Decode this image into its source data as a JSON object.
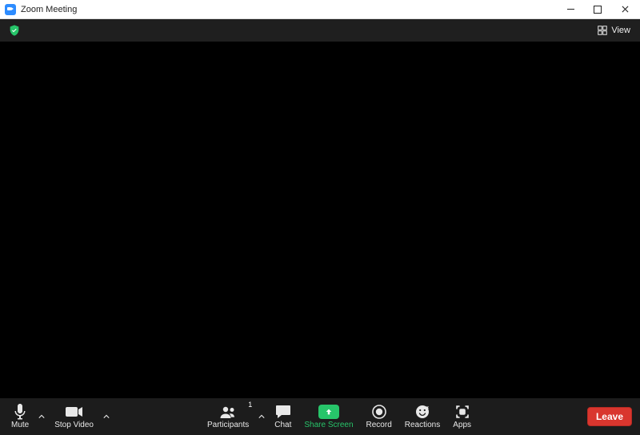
{
  "window": {
    "title": "Zoom Meeting"
  },
  "topbar": {
    "view_label": "View"
  },
  "toolbar": {
    "mute_label": "Mute",
    "stop_video_label": "Stop Video",
    "participants_label": "Participants",
    "participants_count": "1",
    "chat_label": "Chat",
    "share_label": "Share Screen",
    "record_label": "Record",
    "reactions_label": "Reactions",
    "apps_label": "Apps",
    "leave_label": "Leave"
  }
}
